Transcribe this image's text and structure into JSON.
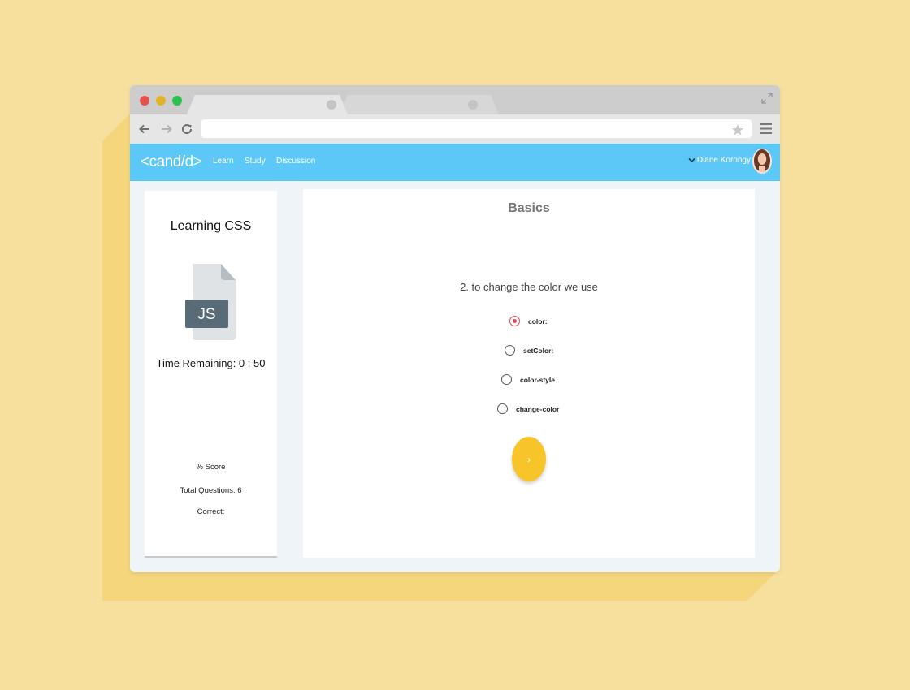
{
  "browser": {
    "tabs": [
      {
        "state": "active"
      },
      {
        "state": "inactive"
      }
    ],
    "address_value": ""
  },
  "app": {
    "logo": "<cand/d>",
    "nav": [
      "Learn",
      "Study",
      "Discussion"
    ],
    "user_name": "Diane Korongy"
  },
  "sidebar": {
    "title": "Learning CSS",
    "file_icon_label": "JS",
    "time_remaining": "Time Remaining: 0 : 50",
    "score_label": "% Score",
    "total_questions": "Total Questions: 6",
    "correct_label": "Correct:"
  },
  "quiz": {
    "section_title": "Basics",
    "question": "2. to change the color we use",
    "options": [
      {
        "label": "color:",
        "selected": true
      },
      {
        "label": "setColor:",
        "selected": false
      },
      {
        "label": "color-style",
        "selected": false
      },
      {
        "label": "change-color",
        "selected": false
      }
    ],
    "next_label": "›"
  },
  "colors": {
    "page_bg": "#f7df9e",
    "appbar": "#5bc8f8",
    "accent_button": "#f7c52a",
    "radio_selected": "#e04a5c",
    "file_badge": "#5a6b78"
  },
  "icons": {
    "window_controls": [
      "close-dot",
      "minimize-dot",
      "maximize-dot"
    ],
    "toolbar": [
      "back-arrow-icon",
      "forward-arrow-icon",
      "reload-icon",
      "star-icon",
      "menu-icon",
      "expand-icon"
    ],
    "user_menu": "chevron-down-icon",
    "sidebar": "file-icon"
  }
}
